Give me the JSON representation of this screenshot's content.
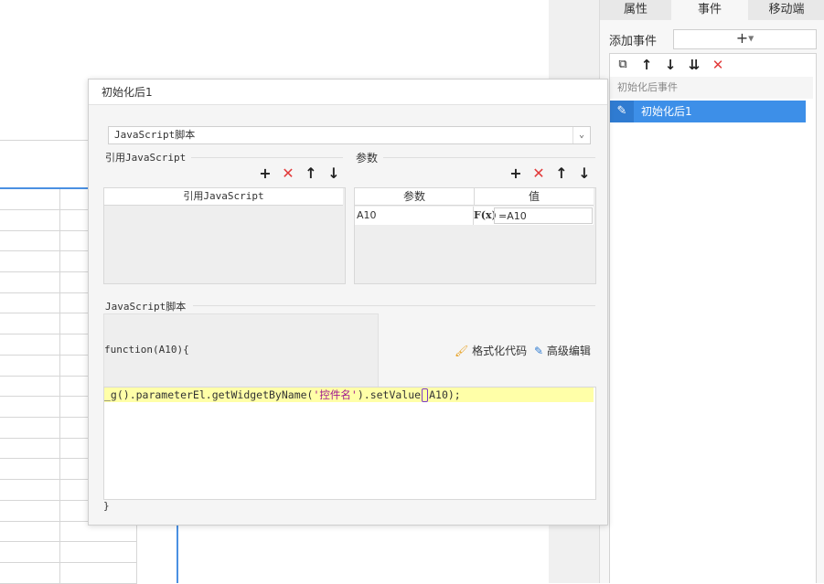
{
  "right_panel": {
    "tabs": [
      {
        "label": "属性"
      },
      {
        "label": "事件"
      },
      {
        "label": "移动端"
      }
    ],
    "add_event_label": "添加事件",
    "add_event_button": "+",
    "event_group": "初始化后事件",
    "event_item": "初始化后1"
  },
  "dialog": {
    "title": "初始化后1",
    "script_type": "JavaScript脚本",
    "ref_section_label": "引用JavaScript",
    "ref_table_header": "引用JavaScript",
    "param_section_label": "参数",
    "param_headers": [
      "参数",
      "值"
    ],
    "param_rows": [
      {
        "name": "A10",
        "fx": "F(x)",
        "value": "=A10"
      }
    ],
    "script_section_label": "JavaScript脚本",
    "function_header": "function(A10){",
    "format_code_label": "格式化代码",
    "advanced_edit_label": "高级编辑",
    "code": {
      "before": "_g().parameterEl.getWidgetByName(",
      "string": "'控件名'",
      "middle": ").setValue",
      "after": "A10);"
    },
    "function_footer": "}"
  },
  "colors": {
    "accent": "#3d8fe8",
    "delete": "#e23a3a",
    "code_highlight": "#ffffa8",
    "code_string": "#a0168e"
  }
}
